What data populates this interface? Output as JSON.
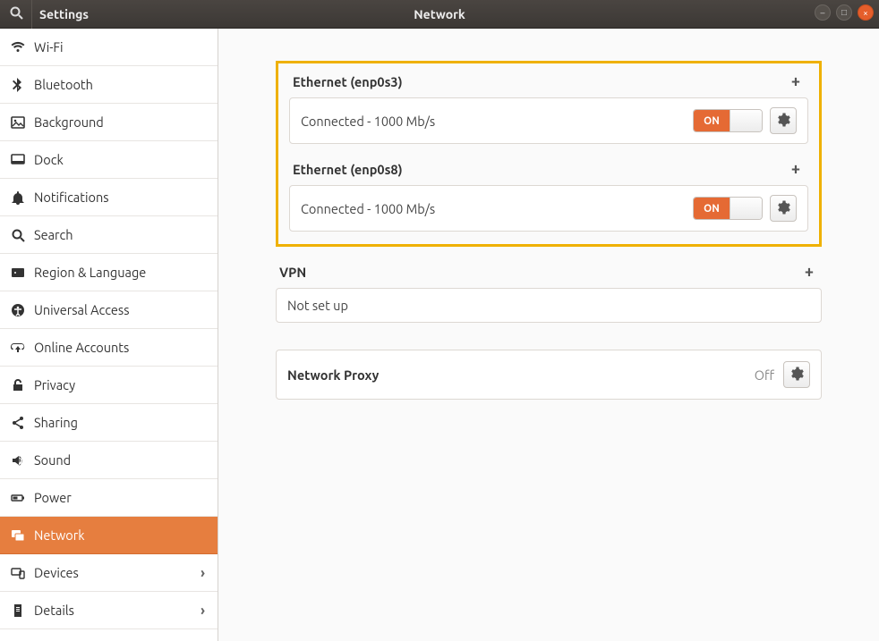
{
  "titlebar": {
    "sidebar_title": "Settings",
    "main_title": "Network"
  },
  "sidebar": {
    "items": [
      {
        "label": "Wi-Fi",
        "icon": "wifi",
        "active": false,
        "expandable": false
      },
      {
        "label": "Bluetooth",
        "icon": "bluetooth",
        "active": false,
        "expandable": false
      },
      {
        "label": "Background",
        "icon": "background",
        "active": false,
        "expandable": false
      },
      {
        "label": "Dock",
        "icon": "dock",
        "active": false,
        "expandable": false
      },
      {
        "label": "Notifications",
        "icon": "bell",
        "active": false,
        "expandable": false
      },
      {
        "label": "Search",
        "icon": "search",
        "active": false,
        "expandable": false
      },
      {
        "label": "Region & Language",
        "icon": "region",
        "active": false,
        "expandable": false
      },
      {
        "label": "Universal Access",
        "icon": "access",
        "active": false,
        "expandable": false
      },
      {
        "label": "Online Accounts",
        "icon": "online",
        "active": false,
        "expandable": false
      },
      {
        "label": "Privacy",
        "icon": "privacy",
        "active": false,
        "expandable": false
      },
      {
        "label": "Sharing",
        "icon": "share",
        "active": false,
        "expandable": false
      },
      {
        "label": "Sound",
        "icon": "sound",
        "active": false,
        "expandable": false
      },
      {
        "label": "Power",
        "icon": "power",
        "active": false,
        "expandable": false
      },
      {
        "label": "Network",
        "icon": "network",
        "active": true,
        "expandable": false
      },
      {
        "label": "Devices",
        "icon": "devices",
        "active": false,
        "expandable": true
      },
      {
        "label": "Details",
        "icon": "details",
        "active": false,
        "expandable": true
      }
    ]
  },
  "main": {
    "ethernet": [
      {
        "title": "Ethernet (enp0s3)",
        "status": "Connected - 1000 Mb/s",
        "toggle": "ON"
      },
      {
        "title": "Ethernet (enp0s8)",
        "status": "Connected - 1000 Mb/s",
        "toggle": "ON"
      }
    ],
    "vpn": {
      "title": "VPN",
      "status": "Not set up"
    },
    "proxy": {
      "title": "Network Proxy",
      "state": "Off"
    }
  }
}
